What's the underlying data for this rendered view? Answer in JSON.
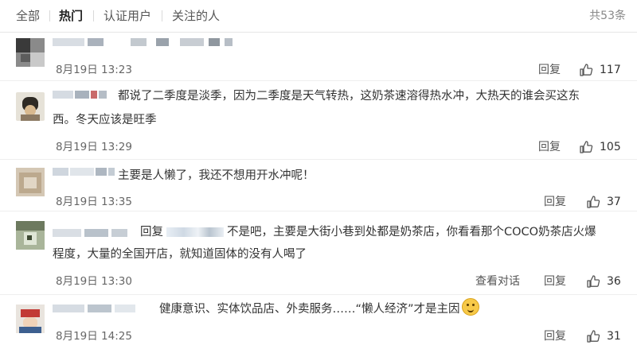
{
  "tabs": [
    {
      "label": "全部"
    },
    {
      "label": "热门"
    },
    {
      "label": "认证用户"
    },
    {
      "label": "关注的人"
    }
  ],
  "total_count": "共53条",
  "comments": [
    {
      "text": "",
      "time": "8月19日 13:23",
      "reply_label": "回复",
      "likes": "117"
    },
    {
      "text": "都说了二季度是淡季，因为二季度是天气转热，这奶茶速溶得热水冲，大热天的谁会买这东西。冬天应该是旺季",
      "text_line1": "都说了二季度是淡季，因为二季度是天气转热，这奶茶速溶得热水冲，大热天的谁会买这东",
      "text_line2": "西。冬天应该是旺季",
      "time": "8月19日 13:29",
      "reply_label": "回复",
      "likes": "105"
    },
    {
      "text": "主要是人懒了，我还不想用开水冲呢！",
      "time": "8月19日 13:35",
      "reply_label": "回复",
      "likes": "37"
    },
    {
      "reply_prefix": "回复",
      "text_line1": "不是吧，主要是大街小巷到处都是奶茶店，你看看那个COCO奶茶店火爆",
      "text_line2": "程度，大量的全国开店，就知道固体的没有人喝了",
      "time": "8月19日 13:30",
      "view_conversation_label": "查看对话",
      "reply_label": "回复",
      "likes": "36"
    },
    {
      "text": "健康意识、实体饮品店、外卖服务……“懒人经济”才是主因",
      "time": "8月19日 14:25",
      "reply_label": "回复",
      "likes": "31"
    }
  ]
}
